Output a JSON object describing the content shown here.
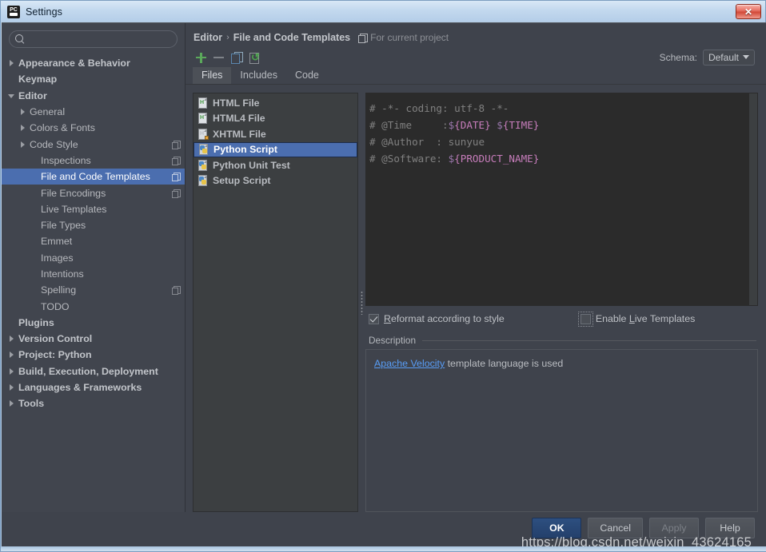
{
  "window": {
    "title": "Settings",
    "app_icon": "pycharm-icon",
    "close_label": "✕"
  },
  "sidebar": {
    "search": {
      "value": "",
      "placeholder": ""
    },
    "items": [
      {
        "label": "Appearance & Behavior",
        "arrow": "right",
        "indent": 0,
        "bold": true,
        "badge": false,
        "selected": false
      },
      {
        "label": "Keymap",
        "arrow": "none",
        "indent": 0,
        "bold": true,
        "badge": false,
        "selected": false
      },
      {
        "label": "Editor",
        "arrow": "down",
        "indent": 0,
        "bold": true,
        "badge": false,
        "selected": false
      },
      {
        "label": "General",
        "arrow": "right",
        "indent": 1,
        "bold": false,
        "badge": false,
        "selected": false
      },
      {
        "label": "Colors & Fonts",
        "arrow": "right",
        "indent": 1,
        "bold": false,
        "badge": false,
        "selected": false
      },
      {
        "label": "Code Style",
        "arrow": "right",
        "indent": 1,
        "bold": false,
        "badge": true,
        "selected": false
      },
      {
        "label": "Inspections",
        "arrow": "none",
        "indent": 2,
        "bold": false,
        "badge": true,
        "selected": false
      },
      {
        "label": "File and Code Templates",
        "arrow": "none",
        "indent": 2,
        "bold": false,
        "badge": true,
        "selected": true
      },
      {
        "label": "File Encodings",
        "arrow": "none",
        "indent": 2,
        "bold": false,
        "badge": true,
        "selected": false
      },
      {
        "label": "Live Templates",
        "arrow": "none",
        "indent": 2,
        "bold": false,
        "badge": false,
        "selected": false
      },
      {
        "label": "File Types",
        "arrow": "none",
        "indent": 2,
        "bold": false,
        "badge": false,
        "selected": false
      },
      {
        "label": "Emmet",
        "arrow": "none",
        "indent": 2,
        "bold": false,
        "badge": false,
        "selected": false
      },
      {
        "label": "Images",
        "arrow": "none",
        "indent": 2,
        "bold": false,
        "badge": false,
        "selected": false
      },
      {
        "label": "Intentions",
        "arrow": "none",
        "indent": 2,
        "bold": false,
        "badge": false,
        "selected": false
      },
      {
        "label": "Spelling",
        "arrow": "none",
        "indent": 2,
        "bold": false,
        "badge": true,
        "selected": false
      },
      {
        "label": "TODO",
        "arrow": "none",
        "indent": 2,
        "bold": false,
        "badge": false,
        "selected": false
      },
      {
        "label": "Plugins",
        "arrow": "none",
        "indent": 0,
        "bold": true,
        "badge": false,
        "selected": false
      },
      {
        "label": "Version Control",
        "arrow": "right",
        "indent": 0,
        "bold": true,
        "badge": false,
        "selected": false
      },
      {
        "label": "Project: Python",
        "arrow": "right",
        "indent": 0,
        "bold": true,
        "badge": false,
        "selected": false
      },
      {
        "label": "Build, Execution, Deployment",
        "arrow": "right",
        "indent": 0,
        "bold": true,
        "badge": false,
        "selected": false
      },
      {
        "label": "Languages & Frameworks",
        "arrow": "right",
        "indent": 0,
        "bold": true,
        "badge": false,
        "selected": false
      },
      {
        "label": "Tools",
        "arrow": "right",
        "indent": 0,
        "bold": true,
        "badge": false,
        "selected": false
      }
    ]
  },
  "breadcrumb": {
    "parent": "Editor",
    "separator": "›",
    "current": "File and Code Templates",
    "scope": "For current project"
  },
  "toolbar": {
    "add_label": "+",
    "remove_label": "−",
    "copy_label": "copy",
    "reset_label": "reset",
    "schema_label": "Schema:",
    "schema_value": "Default"
  },
  "tabs": [
    {
      "label": "Files",
      "active": true
    },
    {
      "label": "Includes",
      "active": false
    },
    {
      "label": "Code",
      "active": false
    }
  ],
  "file_list": [
    {
      "label": "HTML File",
      "icon": "html-file-icon",
      "selected": false
    },
    {
      "label": "HTML4 File",
      "icon": "html-file-icon",
      "selected": false
    },
    {
      "label": "XHTML File",
      "icon": "xhtml-file-icon",
      "selected": false
    },
    {
      "label": "Python Script",
      "icon": "python-file-icon",
      "selected": true
    },
    {
      "label": "Python Unit Test",
      "icon": "python-file-icon",
      "selected": false
    },
    {
      "label": "Setup Script",
      "icon": "python-file-icon",
      "selected": false
    }
  ],
  "code": {
    "lines": [
      [
        {
          "t": "# -*- coding: utf-8 -*-",
          "c": "comment"
        }
      ],
      [
        {
          "t": "# @Time     :",
          "c": "comment"
        },
        {
          "t": "$",
          "c": "dollar"
        },
        {
          "t": "{DATE}",
          "c": "var"
        },
        {
          "t": " ",
          "c": "comment"
        },
        {
          "t": "$",
          "c": "dollar"
        },
        {
          "t": "{TIME}",
          "c": "var"
        }
      ],
      [
        {
          "t": "# @Author  : sunyue",
          "c": "comment"
        }
      ],
      [
        {
          "t": "# @Software: ",
          "c": "comment"
        },
        {
          "t": "$",
          "c": "dollar"
        },
        {
          "t": "{PRODUCT_NAME}",
          "c": "var"
        }
      ]
    ]
  },
  "options": {
    "reformat": {
      "label_pre": "",
      "label_u": "R",
      "label_post": "eformat according to style",
      "checked": true
    },
    "live_templates": {
      "label_pre": "Enable ",
      "label_u": "L",
      "label_post": "ive Templates",
      "checked": false
    }
  },
  "description": {
    "header": "Description",
    "link": "Apache Velocity",
    "rest": " template language is used"
  },
  "buttons": {
    "ok": "OK",
    "cancel": "Cancel",
    "apply": "Apply",
    "help": "Help"
  },
  "watermark": "https://blog.csdn.net/weixin_43624165",
  "colors": {
    "selection": "#4b6eaf",
    "accent_green": "#5ba85b",
    "accent_blue": "#589df6",
    "editor_bg": "#2b2b2b",
    "panel_bg": "#3f434c"
  }
}
